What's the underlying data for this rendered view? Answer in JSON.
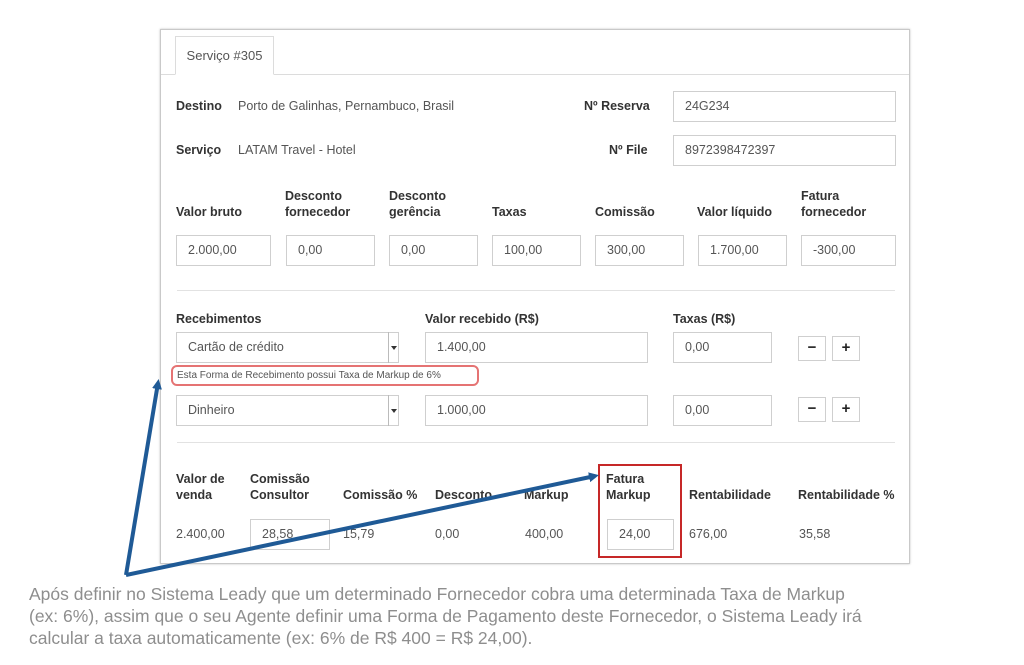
{
  "tab": {
    "label": "Serviço #305"
  },
  "destino": {
    "label": "Destino",
    "value": "Porto de Galinhas, Pernambuco, Brasil"
  },
  "servico": {
    "label": "Serviço",
    "value": "LATAM Travel - Hotel"
  },
  "reserva": {
    "label": "Nº Reserva",
    "value": "24G234"
  },
  "file": {
    "label": "Nº File",
    "value": "8972398472397"
  },
  "values": {
    "headers": {
      "bruto": "Valor bruto",
      "desc_forn_1": "Desconto",
      "desc_forn_2": "fornecedor",
      "desc_ger_1": "Desconto",
      "desc_ger_2": "gerência",
      "taxas": "Taxas",
      "comissao": "Comissão",
      "liquido": "Valor líquido",
      "fatura_1": "Fatura",
      "fatura_2": "fornecedor"
    },
    "inputs": {
      "bruto": "2.000,00",
      "desc_forn": "0,00",
      "desc_ger": "0,00",
      "taxas": "100,00",
      "comissao": "300,00",
      "liquido": "1.700,00",
      "fatura": "-300,00"
    }
  },
  "recebimentos": {
    "header": "Recebimentos",
    "valor_header": "Valor recebido (R$)",
    "taxas_header": "Taxas (R$)",
    "rows": [
      {
        "method": "Cartão de crédito",
        "valor": "1.400,00",
        "taxas": "0,00"
      },
      {
        "method": "Dinheiro",
        "valor": "1.000,00",
        "taxas": "0,00"
      }
    ],
    "note": "Esta Forma de Recebimento possui Taxa de Markup de 6%",
    "minus": "−",
    "plus": "+"
  },
  "summary": {
    "headers": {
      "venda_1": "Valor de",
      "venda_2": "venda",
      "comissao_1": "Comissão",
      "comissao_2": "Consultor",
      "comissao_pct": "Comissão %",
      "desconto": "Desconto",
      "markup": "Markup",
      "fatura_1": "Fatura",
      "fatura_2": "Markup",
      "rent": "Rentabilidade",
      "rent_pct": "Rentabilidade %"
    },
    "values": {
      "venda": "2.400,00",
      "comissao": "28,58",
      "comissao_pct": "15,79",
      "desconto": "0,00",
      "markup": "400,00",
      "fatura": "24,00",
      "rent": "676,00",
      "rent_pct": "35,58"
    }
  },
  "caption": {
    "line1": "Após definir no Sistema Leady que um determinado Fornecedor cobra uma determinada Taxa de Markup",
    "line2": "(ex: 6%), assim que o seu Agente definir uma Forma de Pagamento deste Fornecedor, o Sistema Leady irá",
    "line3": "calcular a taxa automaticamente (ex: 6% de R$ 400 = R$ 24,00)."
  },
  "colors": {
    "arrow": "#1f5a96",
    "highlight": "#c62828",
    "note_border": "#e57373"
  }
}
